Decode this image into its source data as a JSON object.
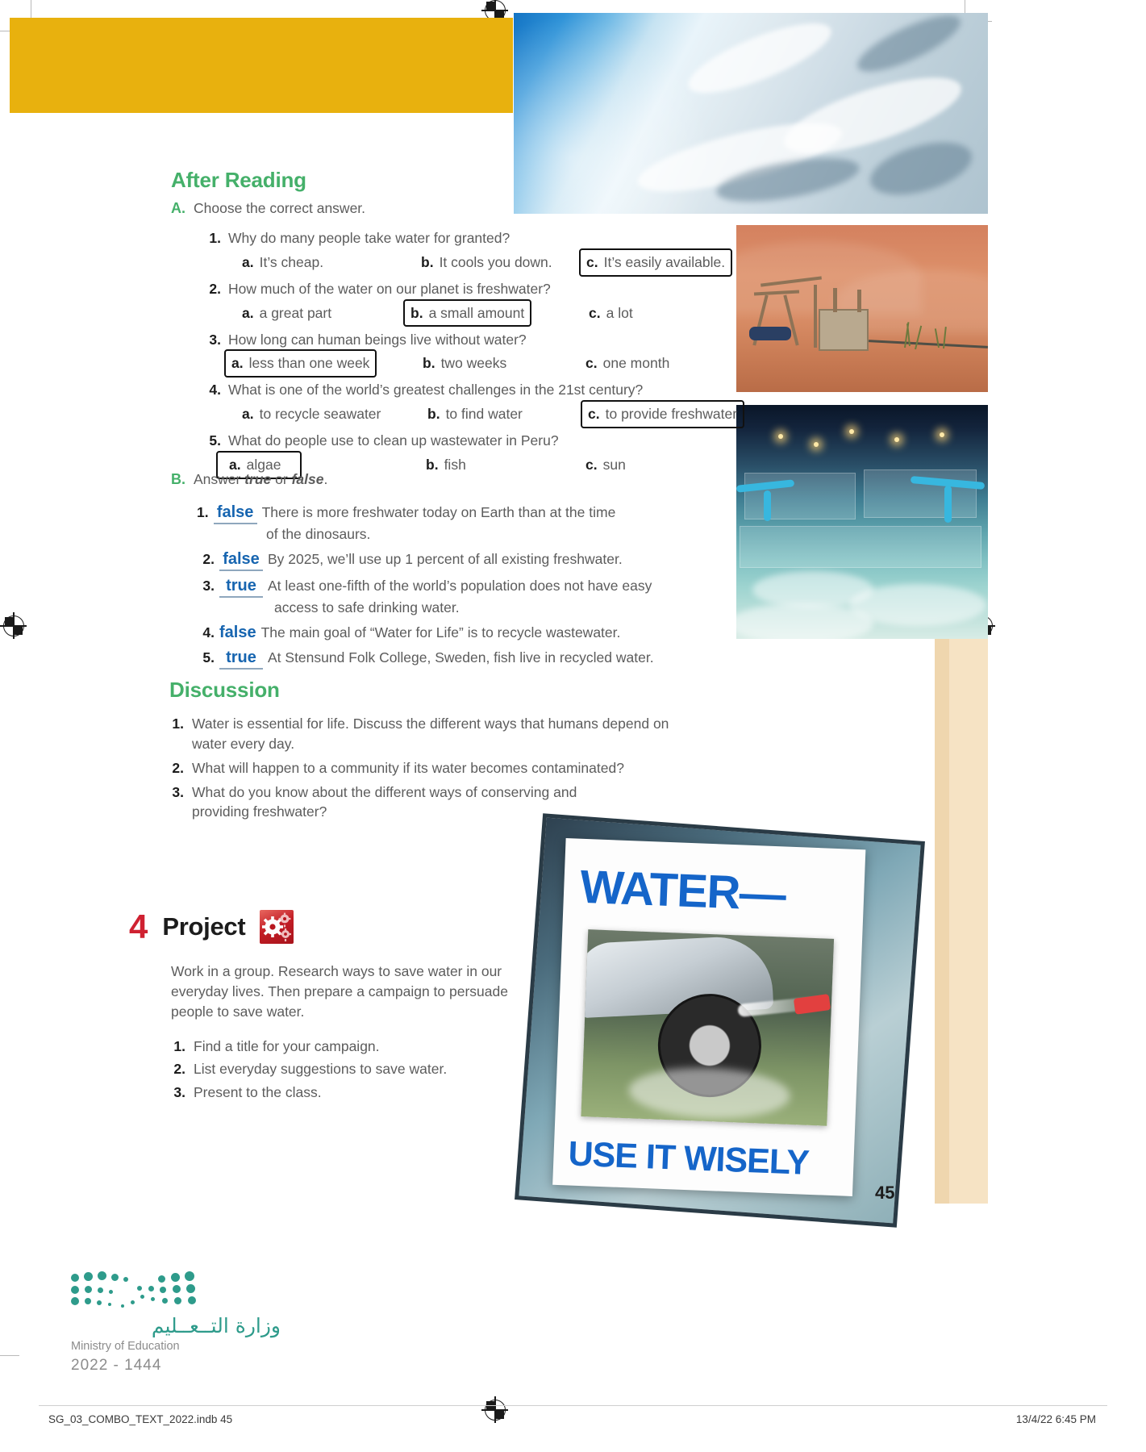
{
  "sections": {
    "after_reading": {
      "heading": "After Reading",
      "part_a": {
        "letter": "A.",
        "instruction": "Choose the correct answer.",
        "questions": [
          {
            "n": "1.",
            "text": "Why do many people take water for granted?",
            "options": [
              {
                "letter": "a.",
                "text": "It’s cheap.",
                "selected": false
              },
              {
                "letter": "b.",
                "text": "It cools you down.",
                "selected": false
              },
              {
                "letter": "c.",
                "text": "It’s easily available.",
                "selected": true
              }
            ]
          },
          {
            "n": "2.",
            "text": "How much of the water on our planet is freshwater?",
            "options": [
              {
                "letter": "a.",
                "text": "a great part",
                "selected": false
              },
              {
                "letter": "b.",
                "text": "a small amount",
                "selected": true
              },
              {
                "letter": "c.",
                "text": "a lot",
                "selected": false
              }
            ]
          },
          {
            "n": "3.",
            "text": "How long can human beings live without water?",
            "options": [
              {
                "letter": "a.",
                "text": "less than one week",
                "selected": true
              },
              {
                "letter": "b.",
                "text": "two weeks",
                "selected": false
              },
              {
                "letter": "c.",
                "text": "one month",
                "selected": false
              }
            ]
          },
          {
            "n": "4.",
            "text": "What is one of the world’s greatest challenges in the 21st century?",
            "options": [
              {
                "letter": "a.",
                "text": "to recycle seawater",
                "selected": false
              },
              {
                "letter": "b.",
                "text": "to find water",
                "selected": false
              },
              {
                "letter": "c.",
                "text": "to provide freshwater",
                "selected": true
              }
            ]
          },
          {
            "n": "5.",
            "text": "What do people use to clean up wastewater in Peru?",
            "options": [
              {
                "letter": "a.",
                "text": "algae",
                "selected": true
              },
              {
                "letter": "b.",
                "text": "fish",
                "selected": false
              },
              {
                "letter": "c.",
                "text": "sun",
                "selected": false
              }
            ]
          }
        ]
      },
      "part_b": {
        "letter": "B.",
        "instruction_pre": "Answer ",
        "instruction_true": "true",
        "instruction_mid": " or ",
        "instruction_false": "false",
        "instruction_post": ".",
        "items": [
          {
            "n": "1.",
            "answer": "false",
            "text": "There is more freshwater today on Earth than at the time",
            "cont": "of the dinosaurs."
          },
          {
            "n": "2.",
            "answer": "false",
            "text": "By 2025, we’ll use up 1 percent of all existing freshwater.",
            "cont": ""
          },
          {
            "n": "3.",
            "answer": "true",
            "text": "At least one-fifth of the world’s population does not have easy",
            "cont": "access to safe drinking water."
          },
          {
            "n": "4.",
            "answer": "false",
            "text": "The main goal of “Water for Life” is to recycle wastewater.",
            "cont": ""
          },
          {
            "n": "5.",
            "answer": "true",
            "text": "At Stensund Folk College, Sweden, fish live in recycled water.",
            "cont": ""
          }
        ]
      }
    },
    "discussion": {
      "heading": "Discussion",
      "items": [
        {
          "n": "1.",
          "text": "Water is essential for life. Discuss the different ways that humans depend on",
          "cont": "water every day."
        },
        {
          "n": "2.",
          "text": "What will happen to a community if its water becomes contaminated?",
          "cont": ""
        },
        {
          "n": "3.",
          "text": "What do you know about the different ways of conserving and",
          "cont": "providing freshwater?"
        }
      ]
    },
    "project": {
      "number": "4",
      "title": "Project",
      "icon": "gears-icon",
      "body": "Work in a group. Research ways to save water in our everyday lives. Then prepare a campaign to persuade people to save water.",
      "items": [
        {
          "n": "1.",
          "text": "Find a title for your campaign."
        },
        {
          "n": "2.",
          "text": "List everyday suggestions to save water."
        },
        {
          "n": "3.",
          "text": "Present to the class."
        }
      ]
    }
  },
  "poster": {
    "title": "WATER—",
    "subtitle": "USE IT WISELY",
    "image_alt": "car-wash-photo"
  },
  "ministry": {
    "arabic": "وزارة التــعــليم",
    "english": "Ministry of Education",
    "years": "2022 - 1444"
  },
  "page_number": "45",
  "footer": {
    "left": "SG_03_COMBO_TEXT_2022.indb   45",
    "right": "13/4/22   6:45 PM"
  },
  "colors": {
    "green_heading": "#45b06a",
    "yellow_band": "#e8b10e",
    "answer_blue": "#1765b0",
    "project_red": "#cf2131",
    "poster_blue": "#1565c9",
    "moe_teal": "#2e9b8b"
  }
}
